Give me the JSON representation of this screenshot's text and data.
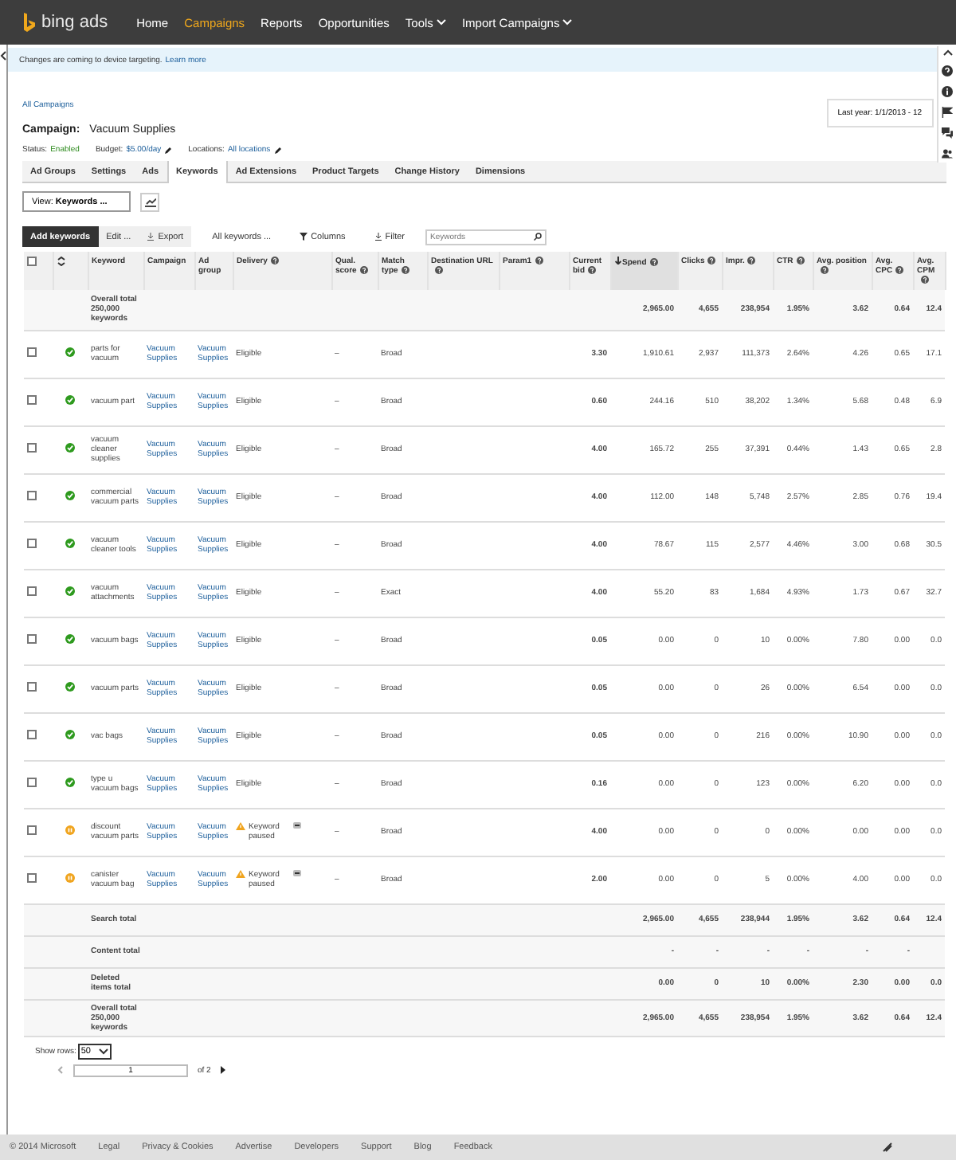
{
  "nav": {
    "logo": "bing ads",
    "items": [
      {
        "label": "Home",
        "selected": false,
        "menu": false
      },
      {
        "label": "Campaigns",
        "selected": true,
        "menu": false
      },
      {
        "label": "Reports",
        "selected": false,
        "menu": false
      },
      {
        "label": "Opportunities",
        "selected": false,
        "menu": false
      },
      {
        "label": "Tools",
        "selected": false,
        "menu": true
      },
      {
        "label": "Import Campaigns",
        "selected": false,
        "menu": true
      }
    ]
  },
  "notice": {
    "text": "Changes are coming to device targeting.",
    "link": "Learn more"
  },
  "breadcrumb": "All Campaigns",
  "campaign": {
    "label": "Campaign:",
    "name": "Vacuum Supplies"
  },
  "date_range": "Last year: 1/1/2013 - 12",
  "meta": [
    {
      "label": "Status:",
      "value": "Enabled",
      "kind": "status"
    },
    {
      "label": "Budget:",
      "value": "$5.00/day",
      "kind": "edit"
    },
    {
      "label": "Locations:",
      "value": "All locations",
      "kind": "edit"
    }
  ],
  "tabs": [
    {
      "label": "Ad Groups",
      "selected": false
    },
    {
      "label": "Settings",
      "selected": false
    },
    {
      "label": "Ads",
      "selected": false
    },
    {
      "label": "Keywords",
      "selected": true
    },
    {
      "label": "Ad Extensions",
      "selected": false
    },
    {
      "label": "Product Targets",
      "selected": false
    },
    {
      "label": "Change History",
      "selected": false
    },
    {
      "label": "Dimensions",
      "selected": false
    }
  ],
  "view": {
    "label": "View:",
    "value": "Keywords ..."
  },
  "toolbar": {
    "primary": "Add keywords",
    "edit": "Edit ...",
    "export": "Export",
    "scope": "All keywords ...",
    "columns": "Columns",
    "filter": "Filter",
    "search": {
      "placeholder": "Keywords"
    }
  },
  "table": {
    "select_all_checked": false,
    "columns": [
      {
        "label": "Keyword",
        "help": false,
        "sorted": false
      },
      {
        "label": "Campaign",
        "help": false,
        "sorted": false
      },
      {
        "label": "Ad group",
        "help": false,
        "sorted": false
      },
      {
        "label": "Delivery",
        "help": true,
        "sorted": false
      },
      {
        "label": "Qual. score",
        "help": true,
        "sorted": false
      },
      {
        "label": "Match type",
        "help": true,
        "sorted": false
      },
      {
        "label": "Destination URL",
        "help": true,
        "sorted": false
      },
      {
        "label": "Param1",
        "help": true,
        "sorted": false
      },
      {
        "label": "Current bid",
        "help": true,
        "sorted": false
      },
      {
        "label": "Spend",
        "help": true,
        "sorted": true
      },
      {
        "label": "Clicks",
        "help": true,
        "sorted": false
      },
      {
        "label": "Impr.",
        "help": true,
        "sorted": false
      },
      {
        "label": "CTR",
        "help": true,
        "sorted": false
      },
      {
        "label": "Avg. position",
        "help": true,
        "sorted": false
      },
      {
        "label": "Avg. CPC",
        "help": true,
        "sorted": false
      },
      {
        "label": "Avg. CPM",
        "help": true,
        "sorted": false
      }
    ],
    "top_total": {
      "label": "Overall total 250,000 keywords",
      "stats": [
        "2,965.00",
        "4,655",
        "238,954",
        "1.95%",
        "3.62",
        "0.64",
        "12.4"
      ]
    },
    "rows": [
      {
        "checked": false,
        "kind": "eligible",
        "keyword": "parts for vacuum",
        "campaign": "Vacuum Supplies",
        "ad_group": "Vacuum Supplies",
        "delivery": "Eligible",
        "qual_score": "–",
        "match_type": "Broad",
        "current_bid": "3.30",
        "stats": [
          "1,910.61",
          "2,937",
          "111,373",
          "2.64%",
          "4.26",
          "0.65",
          "17.1"
        ]
      },
      {
        "checked": false,
        "kind": "eligible",
        "keyword": "vacuum part",
        "campaign": "Vacuum Supplies",
        "ad_group": "Vacuum Supplies",
        "delivery": "Eligible",
        "qual_score": "–",
        "match_type": "Broad",
        "current_bid": "0.60",
        "stats": [
          "244.16",
          "510",
          "38,202",
          "1.34%",
          "5.68",
          "0.48",
          "6.9"
        ]
      },
      {
        "checked": false,
        "kind": "eligible",
        "keyword": "vacuum cleaner supplies",
        "campaign": "Vacuum Supplies",
        "ad_group": "Vacuum Supplies",
        "delivery": "Eligible",
        "qual_score": "–",
        "match_type": "Broad",
        "current_bid": "4.00",
        "stats": [
          "165.72",
          "255",
          "37,391",
          "0.44%",
          "1.43",
          "0.65",
          "2.8"
        ]
      },
      {
        "checked": false,
        "kind": "eligible",
        "keyword": "commercial vacuum parts",
        "campaign": "Vacuum Supplies",
        "ad_group": "Vacuum Supplies",
        "delivery": "Eligible",
        "qual_score": "–",
        "match_type": "Broad",
        "current_bid": "4.00",
        "stats": [
          "112.00",
          "148",
          "5,748",
          "2.57%",
          "2.85",
          "0.76",
          "19.4"
        ]
      },
      {
        "checked": false,
        "kind": "eligible",
        "keyword": "vacuum cleaner tools",
        "campaign": "Vacuum Supplies",
        "ad_group": "Vacuum Supplies",
        "delivery": "Eligible",
        "qual_score": "–",
        "match_type": "Broad",
        "current_bid": "4.00",
        "stats": [
          "78.67",
          "115",
          "2,577",
          "4.46%",
          "3.00",
          "0.68",
          "30.5"
        ]
      },
      {
        "checked": false,
        "kind": "eligible",
        "keyword": "vacuum attachments",
        "campaign": "Vacuum Supplies",
        "ad_group": "Vacuum Supplies",
        "delivery": "Eligible",
        "qual_score": "–",
        "match_type": "Exact",
        "current_bid": "4.00",
        "stats": [
          "55.20",
          "83",
          "1,684",
          "4.93%",
          "1.73",
          "0.67",
          "32.7"
        ]
      },
      {
        "checked": false,
        "kind": "eligible",
        "keyword": "vacuum bags",
        "campaign": "Vacuum Supplies",
        "ad_group": "Vacuum Supplies",
        "delivery": "Eligible",
        "qual_score": "–",
        "match_type": "Broad",
        "current_bid": "0.05",
        "stats": [
          "0.00",
          "0",
          "10",
          "0.00%",
          "7.80",
          "0.00",
          "0.0"
        ]
      },
      {
        "checked": false,
        "kind": "eligible",
        "keyword": "vacuum parts",
        "campaign": "Vacuum Supplies",
        "ad_group": "Vacuum Supplies",
        "delivery": "Eligible",
        "qual_score": "–",
        "match_type": "Broad",
        "current_bid": "0.05",
        "stats": [
          "0.00",
          "0",
          "26",
          "0.00%",
          "6.54",
          "0.00",
          "0.0"
        ]
      },
      {
        "checked": false,
        "kind": "eligible",
        "keyword": "vac bags",
        "campaign": "Vacuum Supplies",
        "ad_group": "Vacuum Supplies",
        "delivery": "Eligible",
        "qual_score": "–",
        "match_type": "Broad",
        "current_bid": "0.05",
        "stats": [
          "0.00",
          "0",
          "216",
          "0.00%",
          "10.90",
          "0.00",
          "0.0"
        ]
      },
      {
        "checked": false,
        "kind": "eligible",
        "keyword": "type u vacuum bags",
        "campaign": "Vacuum Supplies",
        "ad_group": "Vacuum Supplies",
        "delivery": "Eligible",
        "qual_score": "–",
        "match_type": "Broad",
        "current_bid": "0.16",
        "stats": [
          "0.00",
          "0",
          "123",
          "0.00%",
          "6.20",
          "0.00",
          "0.0"
        ]
      },
      {
        "checked": false,
        "kind": "paused",
        "keyword": "discount vacuum parts",
        "campaign": "Vacuum Supplies",
        "ad_group": "Vacuum Supplies",
        "delivery": "Keyword paused",
        "qual_score": "–",
        "match_type": "Broad",
        "current_bid": "4.00",
        "stats": [
          "0.00",
          "0",
          "0",
          "0.00%",
          "0.00",
          "0.00",
          "0.0"
        ]
      },
      {
        "checked": false,
        "kind": "paused",
        "keyword": "canister vacuum bag",
        "campaign": "Vacuum Supplies",
        "ad_group": "Vacuum Supplies",
        "delivery": "Keyword paused",
        "qual_score": "–",
        "match_type": "Broad",
        "current_bid": "2.00",
        "stats": [
          "0.00",
          "0",
          "5",
          "0.00%",
          "4.00",
          "0.00",
          "0.0"
        ]
      }
    ],
    "totals": [
      {
        "label": "Search total",
        "stats": [
          "2,965.00",
          "4,655",
          "238,944",
          "1.95%",
          "3.62",
          "0.64",
          "12.4"
        ]
      },
      {
        "label": "Content total",
        "stats": [
          "-",
          "-",
          "-",
          "-",
          "-",
          "-"
        ]
      },
      {
        "label": "Deleted items total",
        "stats": [
          "0.00",
          "0",
          "10",
          "0.00%",
          "2.30",
          "0.00",
          "0.0"
        ]
      },
      {
        "label": "Overall total 250,000 keywords",
        "stats": [
          "2,965.00",
          "4,655",
          "238,954",
          "1.95%",
          "3.62",
          "0.64",
          "12.4"
        ]
      }
    ]
  },
  "pager": {
    "rows_label": "Show rows:",
    "rows_value": "50",
    "page": "1",
    "of": "of 2"
  },
  "footer": [
    "© 2014 Microsoft",
    "Legal",
    "Privacy & Cookies",
    "Advertise",
    "Developers",
    "Support",
    "Blog",
    "Feedback"
  ]
}
